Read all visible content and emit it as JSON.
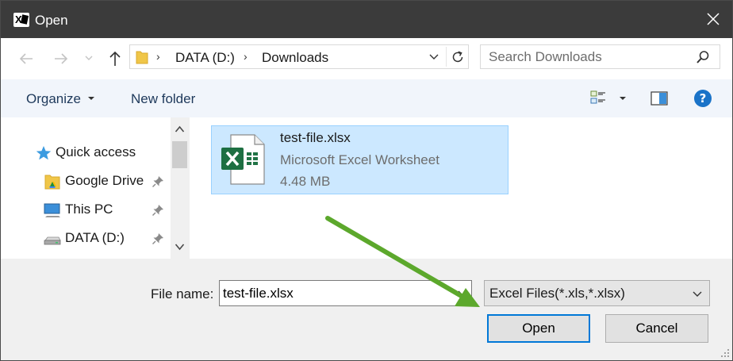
{
  "window": {
    "title": "Open",
    "app_icon": "excel-app-icon",
    "close_icon": "close-icon"
  },
  "nav": {
    "back_icon": "arrow-left-icon",
    "forward_icon": "arrow-right-icon",
    "recent_icon": "chevron-down-icon",
    "up_icon": "arrow-up-icon",
    "address": {
      "crumbs": [
        "DATA (D:)",
        "Downloads"
      ],
      "folder_icon": "folder-icon",
      "refresh_icon": "refresh-icon"
    },
    "search": {
      "placeholder": "Search Downloads",
      "value": "",
      "icon": "search-icon"
    }
  },
  "toolbar": {
    "organize": "Organize",
    "new_folder": "New folder",
    "view_icon": "view-options-icon",
    "preview_icon": "preview-pane-icon",
    "help_icon": "help-icon",
    "help_glyph": "?"
  },
  "sidebar": {
    "items": [
      {
        "label": "Quick access",
        "icon": "star-icon",
        "pinned": false
      },
      {
        "label": "Google Drive",
        "icon": "google-drive-folder-icon",
        "pinned": true
      },
      {
        "label": "This PC",
        "icon": "computer-icon",
        "pinned": true
      },
      {
        "label": "DATA (D:)",
        "icon": "drive-icon",
        "pinned": true
      }
    ]
  },
  "files": [
    {
      "name": "test-file.xlsx",
      "type": "Microsoft Excel Worksheet",
      "size": "4.48 MB",
      "icon": "excel-file-icon",
      "selected": true
    }
  ],
  "footer": {
    "file_name_label": "File name:",
    "file_name_value": "test-file.xlsx",
    "file_type_filter": "Excel Files(*.xls,*.xlsx)",
    "open_label": "Open",
    "cancel_label": "Cancel"
  },
  "colors": {
    "titlebar": "#3b3b3b",
    "toolbar": "#f1f5fb",
    "selection": "#cce8ff",
    "selection_border": "#99d1ff",
    "accent": "#0078d7",
    "arrow": "#5ca82c",
    "excel_green": "#217346"
  }
}
